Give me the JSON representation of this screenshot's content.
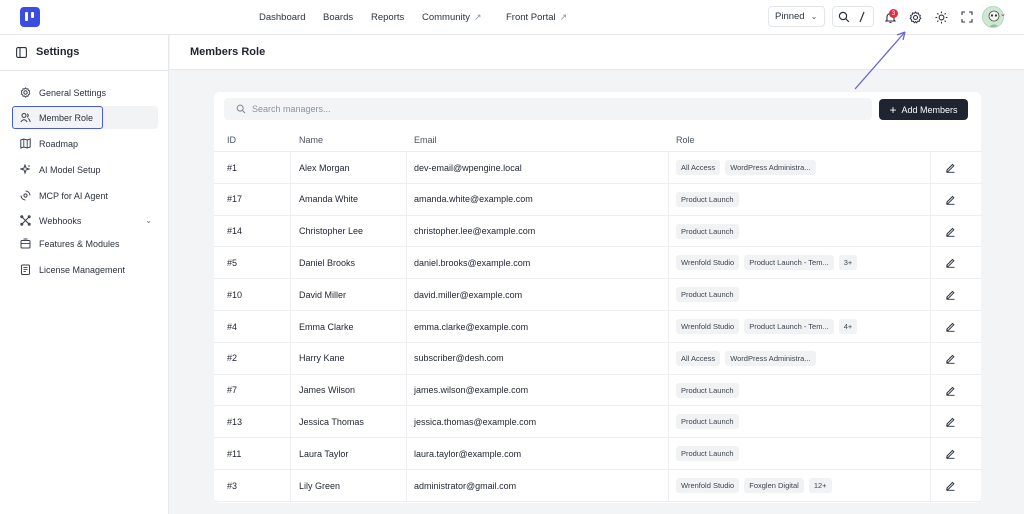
{
  "topnav": {
    "links": [
      "Dashboard",
      "Boards",
      "Reports",
      "Community",
      "Front Portal"
    ],
    "pinned_label": "Pinned",
    "notification_count": "3"
  },
  "sidebar": {
    "title": "Settings",
    "items": [
      {
        "label": "General Settings",
        "icon": "settings-icon"
      },
      {
        "label": "Member Role",
        "icon": "users-icon"
      },
      {
        "label": "Roadmap",
        "icon": "map-icon"
      },
      {
        "label": "AI Model Setup",
        "icon": "sparkle-icon"
      },
      {
        "label": "MCP for AI Agent",
        "icon": "agent-icon"
      },
      {
        "label": "Webhooks",
        "icon": "webhook-icon"
      },
      {
        "label": "Features & Modules",
        "icon": "modules-icon"
      },
      {
        "label": "License Management",
        "icon": "license-icon"
      }
    ],
    "active_index": 1
  },
  "page": {
    "title": "Members Role"
  },
  "search": {
    "placeholder": "Search managers..."
  },
  "add_button_label": "Add Members",
  "table": {
    "headers": [
      "ID",
      "Name",
      "Email",
      "Role"
    ],
    "rows": [
      {
        "id": "#1",
        "name": "Alex Morgan",
        "email": "dev-email@wpengine.local",
        "roles": [
          "All Access",
          "WordPress Administra..."
        ]
      },
      {
        "id": "#17",
        "name": "Amanda White",
        "email": "amanda.white@example.com",
        "roles": [
          "Product Launch"
        ]
      },
      {
        "id": "#14",
        "name": "Christopher Lee",
        "email": "christopher.lee@example.com",
        "roles": [
          "Product Launch"
        ]
      },
      {
        "id": "#5",
        "name": "Daniel Brooks",
        "email": "daniel.brooks@example.com",
        "roles": [
          "Wrenfold Studio",
          "Product Launch - Tem..."
        ],
        "more": "3+"
      },
      {
        "id": "#10",
        "name": "David Miller",
        "email": "david.miller@example.com",
        "roles": [
          "Product Launch"
        ]
      },
      {
        "id": "#4",
        "name": "Emma Clarke",
        "email": "emma.clarke@example.com",
        "roles": [
          "Wrenfold Studio",
          "Product Launch - Tem..."
        ],
        "more": "4+"
      },
      {
        "id": "#2",
        "name": "Harry Kane",
        "email": "subscriber@desh.com",
        "roles": [
          "All Access",
          "WordPress Administra..."
        ]
      },
      {
        "id": "#7",
        "name": "James Wilson",
        "email": "james.wilson@example.com",
        "roles": [
          "Product Launch"
        ]
      },
      {
        "id": "#13",
        "name": "Jessica Thomas",
        "email": "jessica.thomas@example.com",
        "roles": [
          "Product Launch"
        ]
      },
      {
        "id": "#11",
        "name": "Laura Taylor",
        "email": "laura.taylor@example.com",
        "roles": [
          "Product Launch"
        ]
      },
      {
        "id": "#3",
        "name": "Lily Green",
        "email": "administrator@gmail.com",
        "roles": [
          "Wrenfold Studio",
          "Foxglen Digital"
        ],
        "more": "12+"
      }
    ]
  },
  "colors": {
    "accent": "#3b4ce0",
    "primary_button": "#1f2430",
    "badge": "#e02d3c",
    "annotation_arrow": "#6b63d9"
  }
}
